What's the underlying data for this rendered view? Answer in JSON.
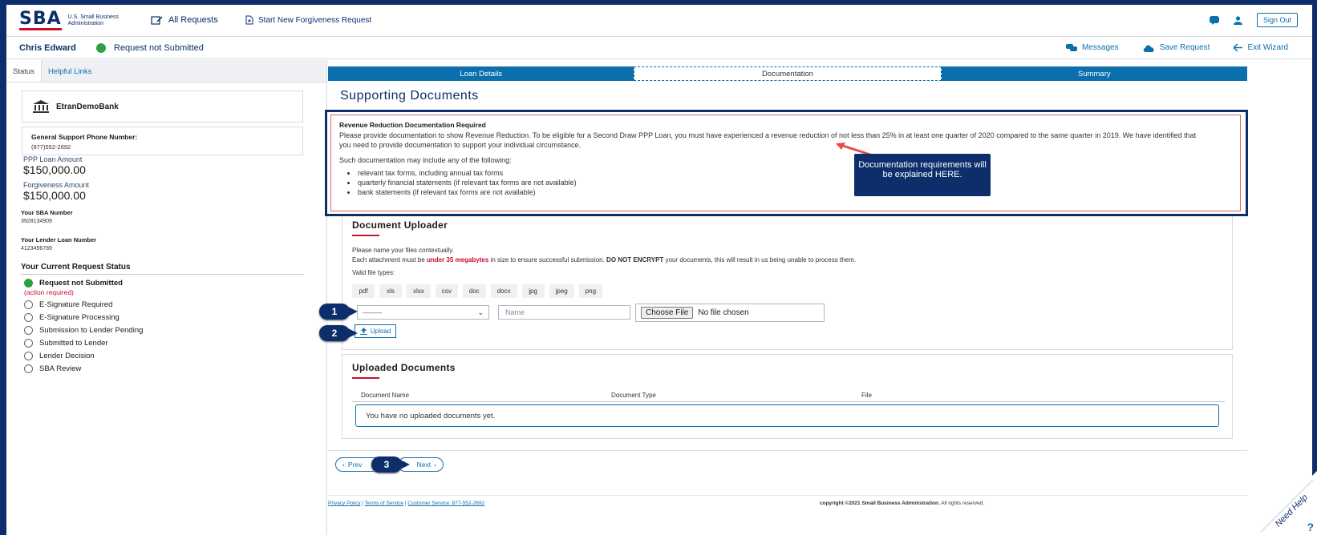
{
  "header": {
    "logo_mark": "SBA",
    "logo_text": "U.S. Small Business Administration",
    "all_requests": "All Requests",
    "start_new": "Start New Forgiveness Request",
    "sign_out": "Sign Out"
  },
  "userbar": {
    "name": "Chris Edward",
    "status": "Request not Submitted",
    "actions": [
      "Messages",
      "Save Request",
      "Exit Wizard"
    ]
  },
  "sidebar": {
    "tabs": [
      "Status",
      "Helpful Links"
    ],
    "bank_name": "EtranDemoBank",
    "phone_label": "General Support Phone Number:",
    "phone": "(877)552-2692",
    "loan_amount_label": "PPP Loan Amount",
    "loan_amount": "$150,000.00",
    "forgiveness_label": "Forgiveness Amount",
    "forgiveness_amount": "$150,000.00",
    "sba_number_label": "Your SBA Number",
    "sba_number": "3928134909",
    "lender_loan_label": "Your Lender Loan Number",
    "lender_loan": "4123456789",
    "status_heading": "Your Current Request Status",
    "statuses": [
      {
        "label": "Request not Submitted",
        "active": true
      },
      {
        "label": "E-Signature Required",
        "active": false
      },
      {
        "label": "E-Signature Processing",
        "active": false
      },
      {
        "label": "Submission to Lender Pending",
        "active": false
      },
      {
        "label": "Submitted to Lender",
        "active": false
      },
      {
        "label": "Lender Decision",
        "active": false
      },
      {
        "label": "SBA Review",
        "active": false
      }
    ],
    "action_required": "(action required)"
  },
  "wizard": {
    "steps": [
      "Loan Details",
      "Documentation",
      "Summary"
    ],
    "current": 1
  },
  "main": {
    "title": "Supporting Documents",
    "rr": {
      "title": "Revenue Reduction Documentation Required",
      "text": "Please provide documentation to show Revenue Reduction. To be eligible for a Second Draw PPP Loan, you must have experienced a revenue reduction of not less than 25% in at least one quarter of 2020 compared to the same quarter in 2019. We have identified that you need to provide documentation to support your individual circumstance.",
      "text2": "Such documentation may include any of the following:",
      "items": [
        "relevant tax forms, including annual tax forms",
        "quarterly financial statements (if relevant tax forms are not available)",
        "bank statements (if relevant tax forms are not available)"
      ]
    },
    "callout": "Documentation requirements will be explained HERE.",
    "uploader": {
      "title": "Document Uploader",
      "note1": "Please name your files contextually.",
      "note2_pre": "Each attachment must be ",
      "note2_red": "under 35 megabytes",
      "note2_mid": " in size to ensure successful submission. ",
      "note2_bold": "DO NOT ENCRYPT",
      "note2_post": " your documents, this will result in us being unable to process them.",
      "valid_label": "Valid file types:",
      "types": [
        "pdf",
        "xls",
        "xlsx",
        "csv",
        "doc",
        "docx",
        "jpg",
        "jpeg",
        "png"
      ],
      "select_value": "---------",
      "name_placeholder": "Name",
      "choose_file": "Choose File",
      "no_file": "No file chosen",
      "upload": "Upload"
    },
    "uploaded": {
      "title": "Uploaded Documents",
      "columns": [
        "Document Name",
        "Document Type",
        "File"
      ],
      "empty": "You have no uploaded documents yet."
    },
    "nav": {
      "prev": "Prev",
      "next": "Next"
    },
    "badges": [
      "1",
      "2",
      "3"
    ]
  },
  "footer": {
    "privacy": "Privacy Policy",
    "terms": "Terms of Service",
    "customer": "Customer Service: 877-552-2692",
    "copyright": "copyright ©2021 Small Business Administration.",
    "rights": "All rights reserved."
  },
  "need_help": "Need Help",
  "colors": {
    "brand_navy": "#0d2e6b",
    "link_blue": "#0b6fae",
    "alert_red": "#c8102e",
    "status_green": "#2ea043"
  }
}
